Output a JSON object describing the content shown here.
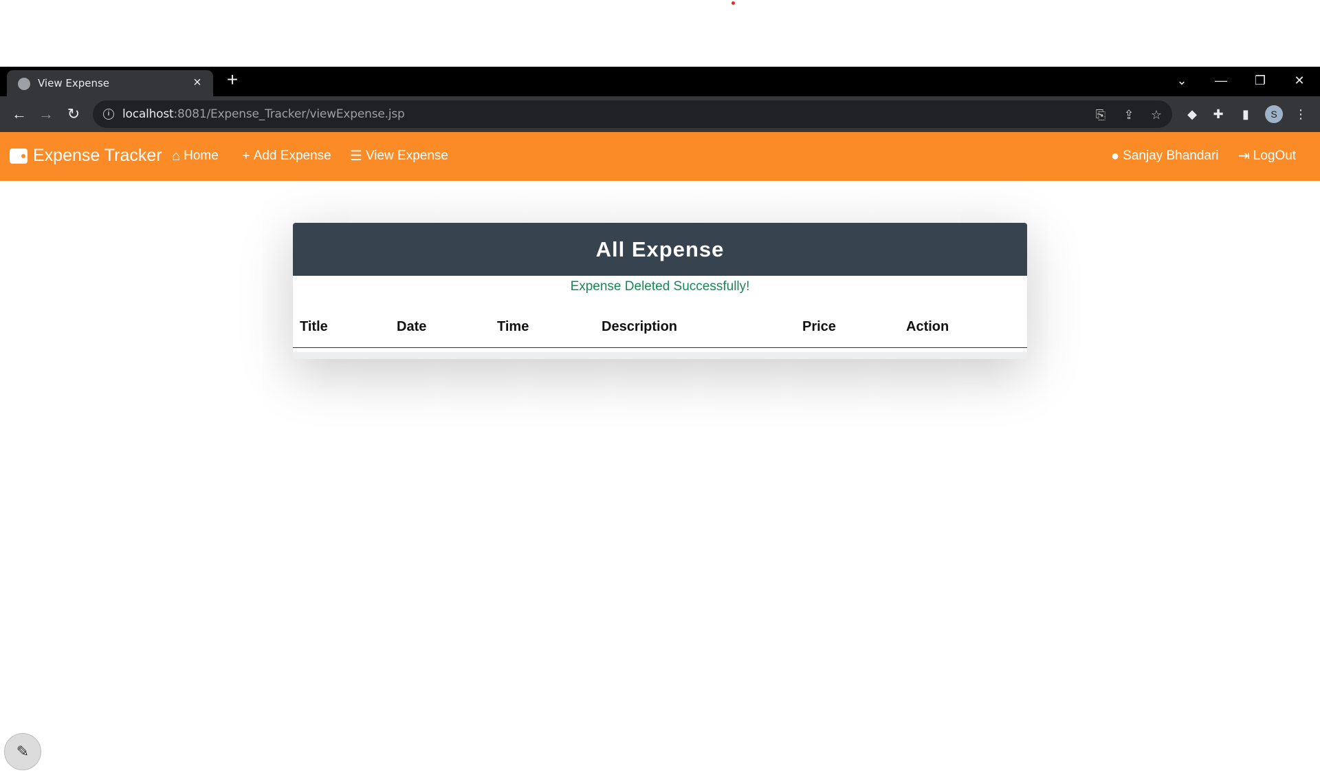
{
  "browser": {
    "tab_title": "View Expense",
    "tab_close": "×",
    "new_tab": "+",
    "url_host": "localhost",
    "url_rest": ":8081/Expense_Tracker/viewExpense.jsp",
    "profile_initial": "S",
    "window_controls": [
      "⌄",
      "—",
      "❐",
      "✕"
    ]
  },
  "navbar": {
    "brand": "Expense Tracker",
    "links": [
      {
        "label": "Home",
        "icon": "home-icon"
      },
      {
        "label": "Add Expense",
        "icon": "plus-icon"
      },
      {
        "label": "View Expense",
        "icon": "list-icon"
      }
    ],
    "user_name": "Sanjay Bhandari",
    "logout": "LogOut",
    "color": "#fa8b26"
  },
  "card": {
    "title": "All Expense",
    "message": "Expense Deleted Successfully!",
    "columns": [
      "Title",
      "Date",
      "Time",
      "Description",
      "Price",
      "Action"
    ],
    "header_color": "#37434f",
    "message_color": "#198754"
  }
}
